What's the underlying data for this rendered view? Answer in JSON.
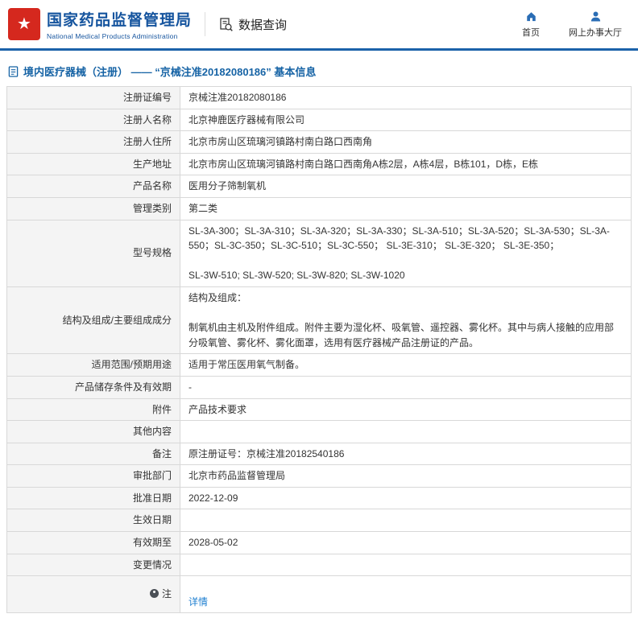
{
  "header": {
    "agency_cn": "国家药品监督管理局",
    "agency_en": "National Medical Products Administration",
    "section_label": "数据查询",
    "nav_home": "首页",
    "nav_hall": "网上办事大厅"
  },
  "breadcrumb": {
    "title": "境内医疗器械（注册） —— “京械注准20182080186” 基本信息"
  },
  "table": {
    "rows": [
      {
        "label": "注册证编号",
        "value": "京械注准20182080186"
      },
      {
        "label": "注册人名称",
        "value": "北京神鹿医疗器械有限公司"
      },
      {
        "label": "注册人住所",
        "value": "北京市房山区琉璃河镇路村南白路口西南角"
      },
      {
        "label": "生产地址",
        "value": "北京市房山区琉璃河镇路村南白路口西南角A栋2层，A栋4层，B栋101，D栋，E栋"
      },
      {
        "label": "产品名称",
        "value": "医用分子筛制氧机"
      },
      {
        "label": "管理类别",
        "value": "第二类"
      },
      {
        "label": "型号规格",
        "value": "SL-3A-300；SL-3A-310；SL-3A-320；SL-3A-330；SL-3A-510；SL-3A-520；SL-3A-530；SL-3A-550；SL-3C-350；SL-3C-510；SL-3C-550； SL-3E-310； SL-3E-320； SL-3E-350；\n\nSL-3W-510; SL-3W-520; SL-3W-820; SL-3W-1020"
      },
      {
        "label": "结构及组成/主要组成成分",
        "value": "结构及组成：\n\n制氧机由主机及附件组成。附件主要为湿化杯、吸氧管、遥控器、雾化杯。其中与病人接触的应用部分吸氧管、雾化杯、雾化面罩，选用有医疗器械产品注册证的产品。"
      },
      {
        "label": "适用范围/预期用途",
        "value": "适用于常压医用氧气制备。"
      },
      {
        "label": "产品储存条件及有效期",
        "value": "-"
      },
      {
        "label": "附件",
        "value": "产品技术要求"
      },
      {
        "label": "其他内容",
        "value": ""
      },
      {
        "label": "备注",
        "value": "原注册证号：京械注准20182540186"
      },
      {
        "label": "审批部门",
        "value": "北京市药品监督管理局"
      },
      {
        "label": "批准日期",
        "value": "2022-12-09"
      },
      {
        "label": "生效日期",
        "value": ""
      },
      {
        "label": "有效期至",
        "value": "2028-05-02"
      },
      {
        "label": "变更情况",
        "value": ""
      }
    ],
    "note": {
      "label": "注",
      "link_label": "详情"
    }
  },
  "icons": {
    "emblem": "national-emblem",
    "section": "document-search",
    "home": "home",
    "hall": "person",
    "breadcrumb": "document",
    "note": "dot-badge"
  },
  "colors": {
    "header_blue": "#15549e",
    "divider_blue": "#1b62a9",
    "emblem_red": "#d5281e",
    "link_blue": "#1e7fd0",
    "label_bg": "#f4f4f4"
  }
}
